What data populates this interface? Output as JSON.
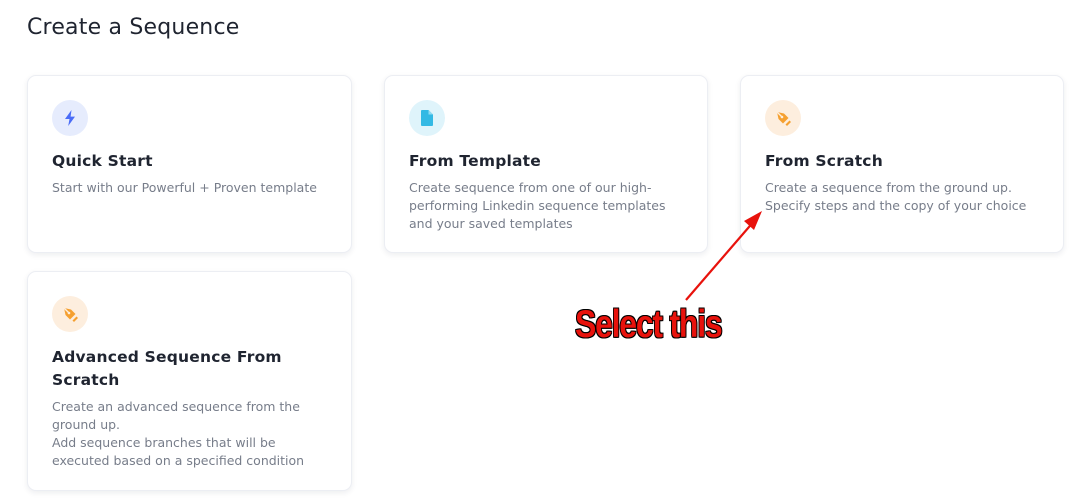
{
  "page": {
    "title": "Create a Sequence"
  },
  "cards": {
    "quick_start": {
      "icon": "lightning-icon",
      "icon_color": "#4a6cf7",
      "title": "Quick Start",
      "description": "Start with our Powerful + Proven template"
    },
    "from_template": {
      "icon": "document-icon",
      "icon_color": "#33b9e4",
      "title": "From Template",
      "description": "Create sequence from one of our high-performing Linkedin sequence templates and your saved templates"
    },
    "from_scratch": {
      "icon": "pen-nib-icon",
      "icon_color": "#f5a030",
      "title": "From Scratch",
      "description": "Create a sequence from the ground up. Specify steps and the copy of your choice"
    },
    "advanced": {
      "icon": "pen-nib-icon",
      "icon_color": "#f5a030",
      "title": "Advanced Sequence From Scratch",
      "description_line1": "Create an advanced sequence from the ground up.",
      "description_line2": "Add sequence branches that will be executed based on a specified condition"
    }
  },
  "annotation": {
    "text": "Select this",
    "color": "#e8120c"
  }
}
